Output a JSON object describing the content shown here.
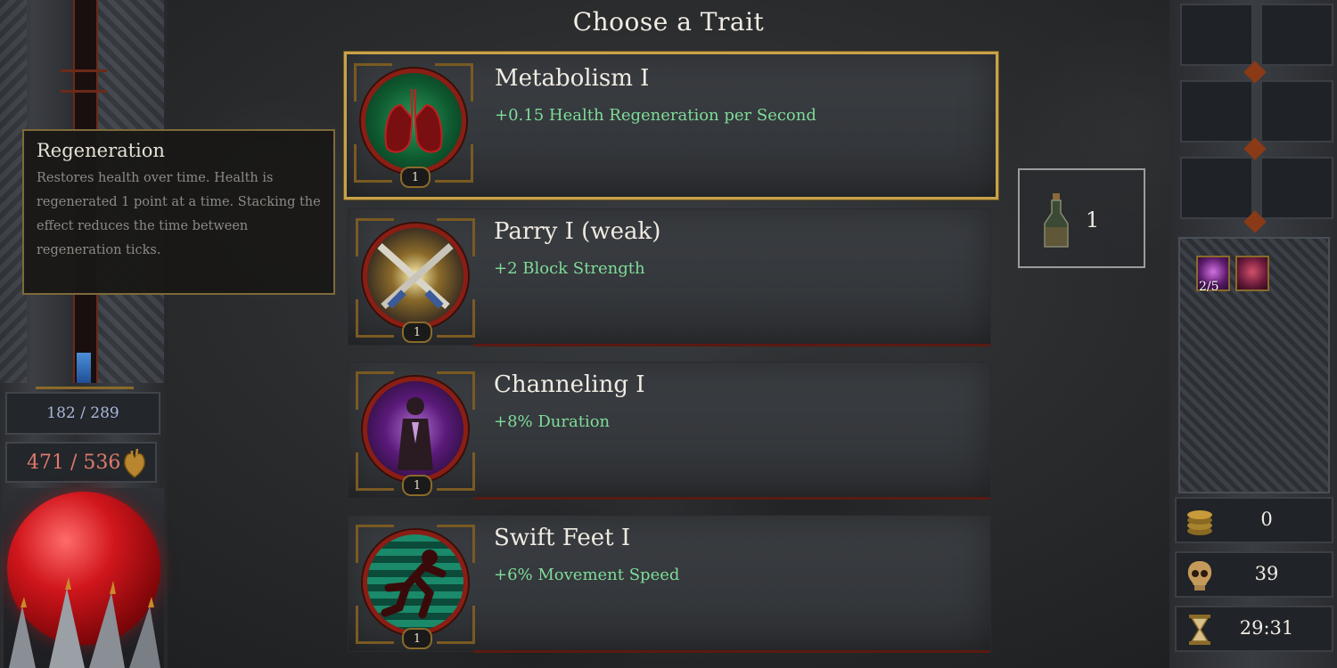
{
  "screen": {
    "title": "Choose a Trait"
  },
  "tooltip": {
    "title": "Regeneration",
    "text": "Restores health over time. Health is regenerated 1 point at a time. Stacking the effect reduces the time between regeneration ticks."
  },
  "player": {
    "mana": "182 / 289",
    "health": "471 / 536",
    "mana_bar_fraction": 0.08
  },
  "traits": [
    {
      "name": "Metabolism I",
      "effect": "+0.15 Health Regeneration per Second",
      "level": "1",
      "icon": "lungs-icon",
      "selected": true
    },
    {
      "name": "Parry I (weak)",
      "effect": "+2 Block Strength",
      "level": "1",
      "icon": "crossed-swords-icon",
      "selected": false
    },
    {
      "name": "Channeling I",
      "effect": "+8% Duration",
      "level": "1",
      "icon": "meditating-figure-icon",
      "selected": false
    },
    {
      "name": "Swift Feet I",
      "effect": "+6% Movement Speed",
      "level": "1",
      "icon": "running-figure-icon",
      "selected": false
    }
  ],
  "potion": {
    "icon": "potion-bottle-icon",
    "count": "1"
  },
  "buffs": [
    {
      "icon": "purple-skull-buff-icon",
      "stack": "2/5"
    },
    {
      "icon": "red-demon-buff-icon"
    }
  ],
  "resources": {
    "gold": {
      "icon": "gold-coins-icon",
      "value": "0"
    },
    "kills": {
      "icon": "skull-icon",
      "value": "39"
    },
    "timer": {
      "icon": "hourglass-icon",
      "value": "29:31"
    }
  },
  "colors": {
    "accent_gold": "#c9a24a",
    "effect_green": "#7fdc9a",
    "health_red": "#e07a6c",
    "mana_blue": "#a9b8d9"
  }
}
